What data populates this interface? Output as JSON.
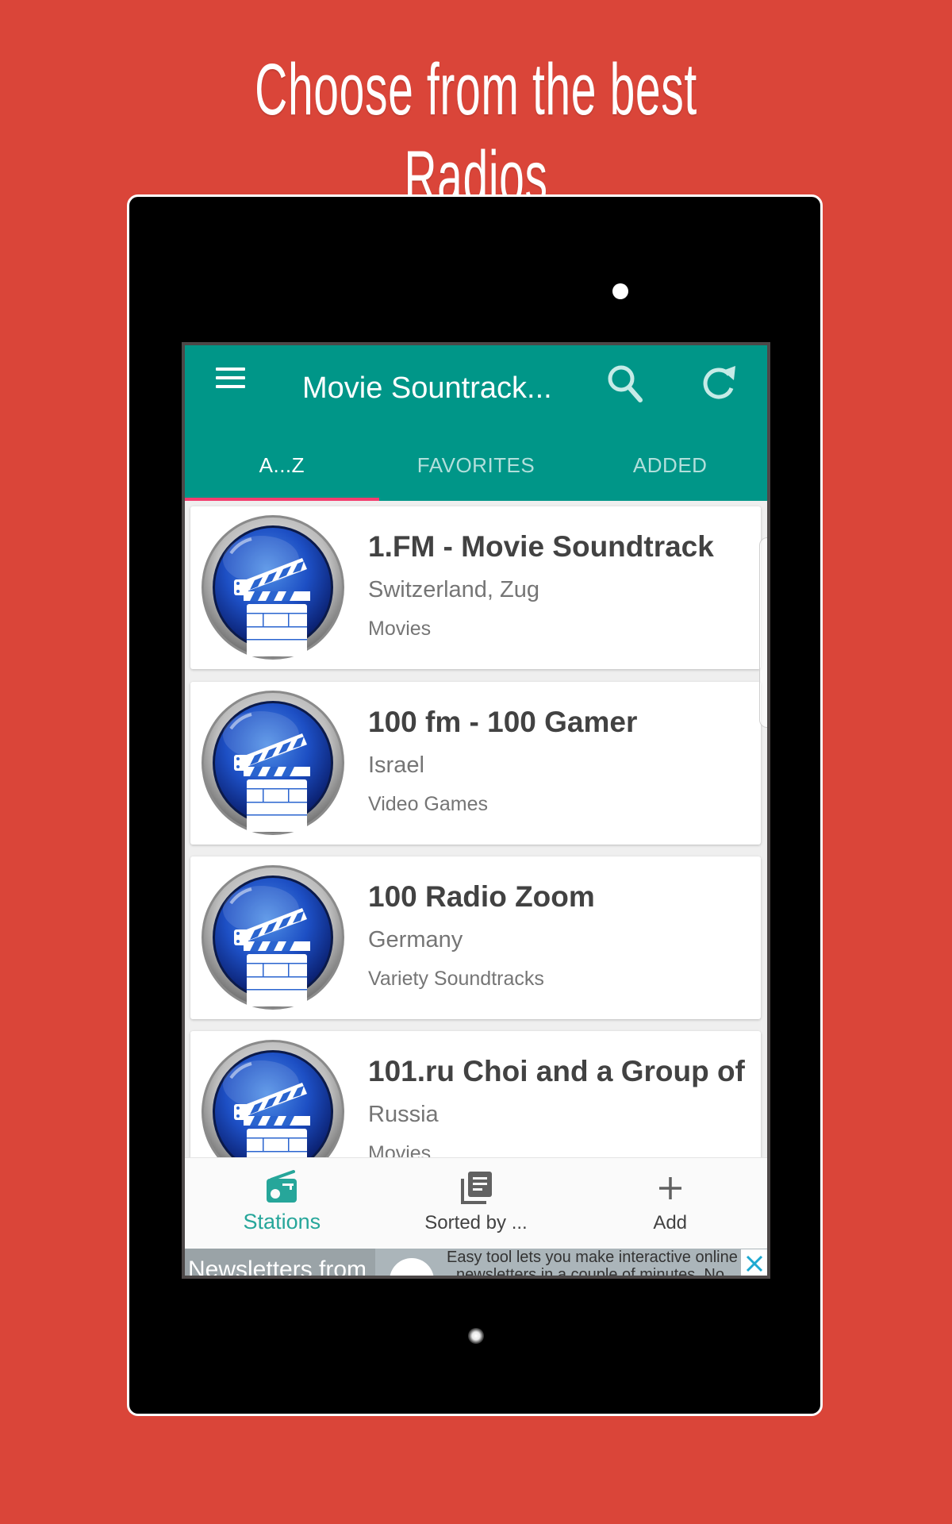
{
  "promo": {
    "headline": "Choose from the best Radios"
  },
  "colors": {
    "background": "#DA4539",
    "app_bar": "#009688",
    "tab_indicator": "#F23D6E",
    "active_nav": "#26A69A"
  },
  "app_bar": {
    "menu_icon": "hamburger-menu-icon",
    "title": "Movie Sountrack...",
    "search_icon": "search-icon",
    "refresh_icon": "refresh-icon"
  },
  "tabs": [
    {
      "label": "A...Z",
      "active": true
    },
    {
      "label": "FAVORITES",
      "active": false
    },
    {
      "label": "ADDED",
      "active": false
    }
  ],
  "stations": [
    {
      "name": "1.FM - Movie Soundtrack",
      "location": "Switzerland, Zug",
      "genre": "Movies",
      "icon": "clapperboard-icon"
    },
    {
      "name": "100 fm - 100 Gamer",
      "location": "Israel",
      "genre": "Video Games",
      "icon": "clapperboard-icon"
    },
    {
      "name": "100 Radio Zoom",
      "location": "Germany",
      "genre": "Variety Soundtracks",
      "icon": "clapperboard-icon"
    },
    {
      "name": "101.ru Choi and a Group of",
      "location": "Russia",
      "genre": "Movies",
      "icon": "clapperboard-icon"
    }
  ],
  "bottom_nav": [
    {
      "label": "Stations",
      "icon": "radio-icon",
      "active": true
    },
    {
      "label": "Sorted by ...",
      "icon": "library-books-icon",
      "active": false
    },
    {
      "label": "Add",
      "icon": "plus-icon",
      "active": false
    }
  ],
  "ad": {
    "left_text": "Newsletters from",
    "line1": "Easy tool lets you make interactive online",
    "line2": "newsletters in a couple of minutes. No",
    "close_icon": "close-icon"
  }
}
